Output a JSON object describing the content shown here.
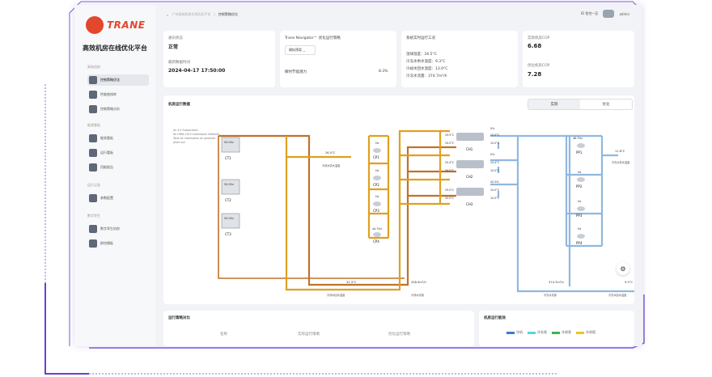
{
  "brand": {
    "logo_text": "TRANE",
    "platform_title": "高效机房在线优化平台"
  },
  "sidebar": {
    "groups": [
      {
        "label": "高效机房",
        "items": [
          "控制策略优化",
          "性能曲线库",
          "控制策略分析"
        ]
      },
      {
        "label": "能源看板",
        "items": [
          "能效看板",
          "运行看板",
          "用能报告"
        ]
      },
      {
        "label": "运行记录",
        "items": [
          "参数配置"
        ]
      },
      {
        "label": "数字孪生",
        "items": [
          "数字孪生机房",
          "群控模板"
        ]
      }
    ]
  },
  "breadcrumb": [
    "首页",
    "广州高效机房在线优化平台",
    "控制策略优化"
  ],
  "topbar": {
    "user_label": "ID 智控一区",
    "avatar_label": "admin"
  },
  "status_card": {
    "comm_label": "通讯状态",
    "comm_value": "正常",
    "update_label": "最新数据时间",
    "update_value": "2024-04-17 17:50:00"
  },
  "strategy_card": {
    "title": "Trane Navigator™ 优化运行策略",
    "select_value": "模拟预案",
    "saving_label": "瞬时节能潜力",
    "saving_value": "8.3%"
  },
  "condition_card": {
    "title": "系统实时运行工况",
    "rows": [
      {
        "label": "湿球温度：",
        "value": "26.5°C"
      },
      {
        "label": "冷冻水供水温度：",
        "value": "9.3°C"
      },
      {
        "label": "冷却水回水温度：",
        "value": "13.9°C"
      },
      {
        "label": "冷冻水流量：",
        "value": "374.7m³/h"
      }
    ]
  },
  "cop_card": {
    "actual_label": "实际机房COP",
    "actual_value": "6.68",
    "opt_label": "优化机房COP",
    "opt_value": "7.28"
  },
  "data_panel": {
    "title": "机房运行数据",
    "tabs": [
      "实际",
      "优化"
    ],
    "active_tab": "实际"
  },
  "diagram": {
    "note_lines": [
      "Air 4.5 Evaporation",
      "for HIMA 2015 Submission Software",
      "Total for information on powered",
      "plant use"
    ],
    "towers": [
      {
        "name": "CT1",
        "hz": "50.0Hz"
      },
      {
        "name": "CT2",
        "hz": "50.0Hz"
      },
      {
        "name": "CT3",
        "hz": "50.0Hz"
      }
    ],
    "cond_pumps": [
      {
        "name": "CP1",
        "hz": "Hz"
      },
      {
        "name": "CP2",
        "hz": "Hz"
      },
      {
        "name": "CP3",
        "hz": "Hz"
      },
      {
        "name": "CP4",
        "hz": "44.7Hz"
      }
    ],
    "chillers": [
      {
        "name": "CH1",
        "pct": "0%",
        "cw_in": "29.5°C",
        "cw_out": "29.5°C",
        "chw_in": "10.0°C",
        "chw_out": "10.0°C"
      },
      {
        "name": "CH2",
        "pct": "0%",
        "cw_in": "29.4°C",
        "cw_out": "29.5°C",
        "chw_in": "10.4°C",
        "chw_out": "10.0°C"
      },
      {
        "name": "CH3",
        "pct": "42.5%",
        "cw_in": "29.5°C",
        "cw_out": "32.5°C",
        "chw_in": "10.0°C",
        "chw_out": "10.0°C"
      }
    ],
    "prim_pumps": [
      {
        "name": "PP1",
        "hz": "48.7Hz"
      },
      {
        "name": "PP2",
        "hz": "Hz"
      },
      {
        "name": "PP3",
        "hz": "Hz"
      },
      {
        "name": "PP4",
        "hz": "Hz"
      }
    ],
    "tower_out_temp": "26.4°C",
    "tower_out_label": "冷却水供水温度",
    "cond_return_temp": "31.3°C",
    "cond_return_label": "冷却水回水温度",
    "cond_flow": "338.5m³/h",
    "cond_flow_label": "冷却水流量",
    "chw_supply_temp": "11.8°C",
    "chw_supply_label": "冷冻水供水温度",
    "chw_flow": "374.7m³/h",
    "chw_flow_label": "冷冻水流量",
    "chw_return_temp": "9.3°C",
    "chw_return_label": "冷冻水回水温度"
  },
  "bottom_left": {
    "title": "运行策略对比",
    "cols": [
      "名称",
      "实际运行策略",
      "优化运行策略"
    ]
  },
  "bottom_right": {
    "title": "机房运行能效",
    "legend": [
      {
        "label": "冷机",
        "color": "#3a7bd5"
      },
      {
        "label": "冷冻泵",
        "color": "#5ad1e6"
      },
      {
        "label": "冷却泵",
        "color": "#3cb44b"
      },
      {
        "label": "冷却塔",
        "color": "#f0c419"
      }
    ]
  },
  "colors": {
    "hot": "#c0722a",
    "warm": "#e0a020",
    "cool": "#8fb8e0",
    "accent": "#e3472c"
  }
}
